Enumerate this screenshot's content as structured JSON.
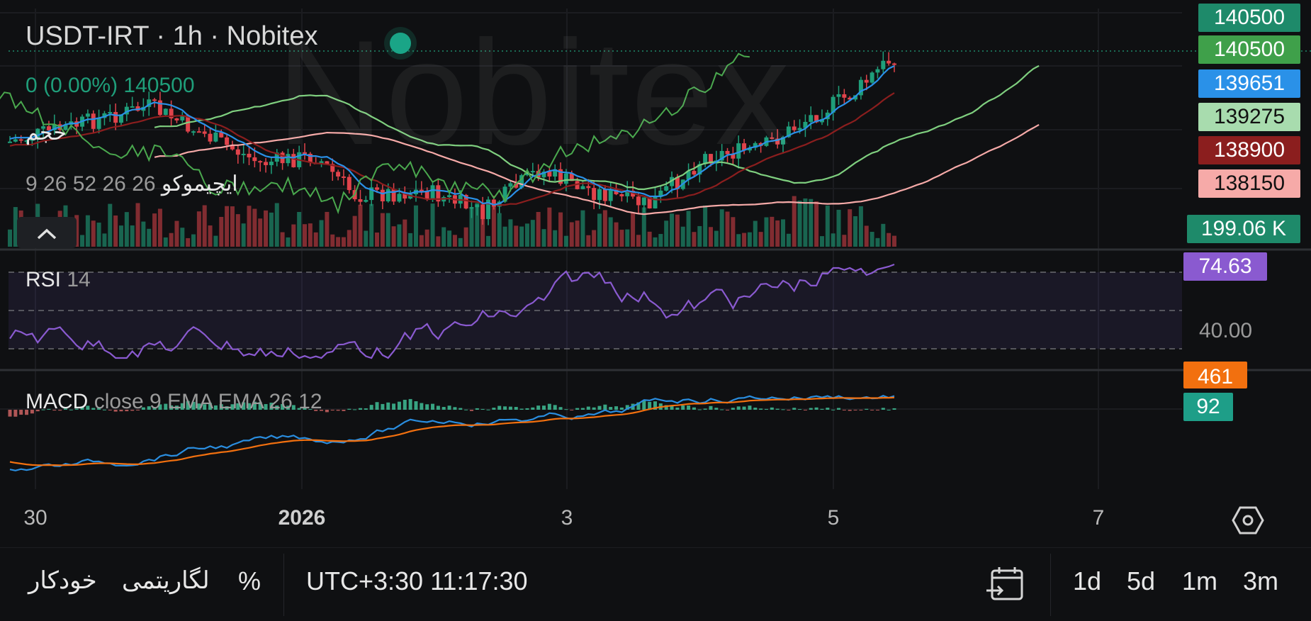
{
  "symbol_title": "USDT-IRT · 1h · Nobitex",
  "watermark": "Nobitex",
  "quote_change": "0 (0.00%)",
  "quote_price": "140500",
  "volume_label": "حجم",
  "ichimoku": {
    "name": "ایچیموکو",
    "params": "26 26 52 26 9"
  },
  "rsi": {
    "name": "RSI",
    "params": "14",
    "value": "74.63",
    "level_label": "40.00"
  },
  "macd": {
    "name": "MACD",
    "params": "close 9 EMA EMA 26 12",
    "value_signal": "461",
    "value_hist": "92"
  },
  "price_tags": [
    {
      "text": "140500",
      "color": "#1e8a6a",
      "fg": "#ffffff"
    },
    {
      "text": "140500",
      "color": "#3fa04a",
      "fg": "#ffffff"
    },
    {
      "text": "139651",
      "color": "#2a91e8",
      "fg": "#ffffff"
    },
    {
      "text": "139275",
      "color": "#a8dcae",
      "fg": "#111111"
    },
    {
      "text": "138900",
      "color": "#8b1e1e",
      "fg": "#ffffff"
    },
    {
      "text": "138150",
      "color": "#f6aaa8",
      "fg": "#111111"
    }
  ],
  "volume_tag": {
    "text": "199.06 K",
    "color": "#1e8a6a"
  },
  "rsi_tag_color": "#8a5ad0",
  "macd_tag_colors": {
    "signal": "#f2700f",
    "hist": "#1e9e88"
  },
  "x_axis_labels": [
    {
      "text": "30",
      "bold": false
    },
    {
      "text": "2026",
      "bold": true
    },
    {
      "text": "3",
      "bold": false
    },
    {
      "text": "5",
      "bold": false
    },
    {
      "text": "7",
      "bold": false
    }
  ],
  "toolbar": {
    "auto": "خودکار",
    "log": "لگاریتمی",
    "percent": "%",
    "time": "UTC+3:30 11:17:30",
    "ranges": [
      "1d",
      "5d",
      "1m",
      "3m"
    ]
  },
  "colors": {
    "up": "#1f9e7a",
    "down": "#e0434b",
    "rsi_line": "#8a5ad0",
    "macd_line": "#2a8ee0",
    "signal_line": "#f2700f",
    "kijun": "#8b1e1e",
    "tenkan": "#2a91e8",
    "span_a": "#7fcf7f",
    "span_b": "#f6aaa8",
    "chikou": "#4aa84e"
  }
}
